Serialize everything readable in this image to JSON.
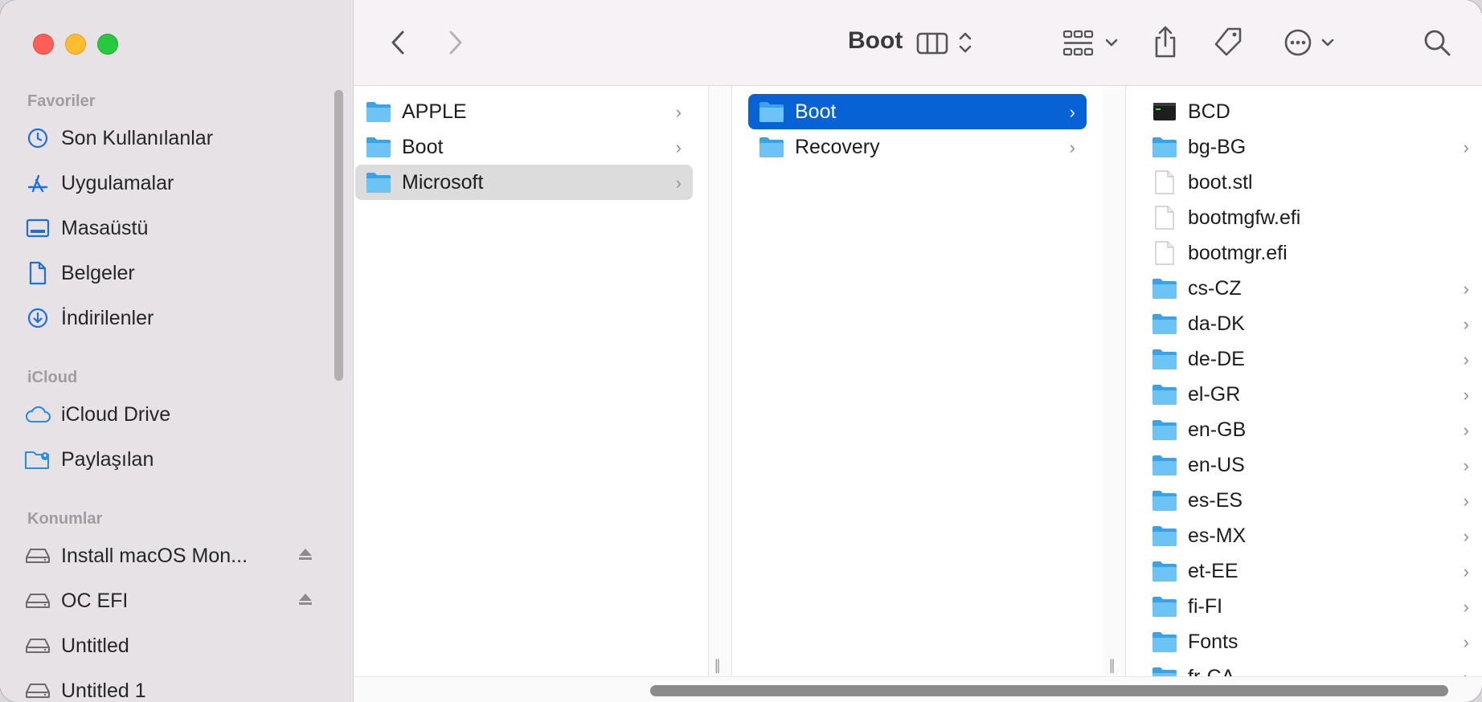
{
  "window": {
    "title": "Boot"
  },
  "sidebar": {
    "sections": [
      {
        "title": "Favoriler"
      },
      {
        "title": "iCloud"
      },
      {
        "title": "Konumlar"
      }
    ],
    "favorites": [
      {
        "label": "Son Kullanılanlar",
        "icon": "clock-icon"
      },
      {
        "label": "Uygulamalar",
        "icon": "apps-icon"
      },
      {
        "label": "Masaüstü",
        "icon": "desktop-icon"
      },
      {
        "label": "Belgeler",
        "icon": "document-icon"
      },
      {
        "label": "İndirilenler",
        "icon": "download-icon"
      }
    ],
    "icloud": [
      {
        "label": "iCloud Drive",
        "icon": "cloud-icon"
      },
      {
        "label": "Paylaşılan",
        "icon": "shared-folder-icon"
      }
    ],
    "locations": [
      {
        "label": "Install macOS Mon...",
        "icon": "drive-icon",
        "eject": true
      },
      {
        "label": "OC EFI",
        "icon": "drive-icon",
        "eject": true
      },
      {
        "label": "Untitled",
        "icon": "drive-icon"
      },
      {
        "label": "Untitled 1",
        "icon": "drive-icon"
      }
    ]
  },
  "toolbar": {
    "title": "Boot",
    "back": "back-icon",
    "forward": "forward-icon",
    "view": "column-view-icon",
    "group": "group-icon",
    "share": "share-icon",
    "tags": "tag-icon",
    "more": "more-icon",
    "search": "search-icon"
  },
  "columns": {
    "col1": [
      {
        "name": "APPLE",
        "type": "folder"
      },
      {
        "name": "Boot",
        "type": "folder"
      },
      {
        "name": "Microsoft",
        "type": "folder",
        "selected": "inactive"
      }
    ],
    "col2": [
      {
        "name": "Boot",
        "type": "folder",
        "selected": "active"
      },
      {
        "name": "Recovery",
        "type": "folder"
      }
    ],
    "col3": [
      {
        "name": "BCD",
        "type": "exec"
      },
      {
        "name": "bg-BG",
        "type": "folder"
      },
      {
        "name": "boot.stl",
        "type": "file"
      },
      {
        "name": "bootmgfw.efi",
        "type": "file"
      },
      {
        "name": "bootmgr.efi",
        "type": "file"
      },
      {
        "name": "cs-CZ",
        "type": "folder"
      },
      {
        "name": "da-DK",
        "type": "folder"
      },
      {
        "name": "de-DE",
        "type": "folder"
      },
      {
        "name": "el-GR",
        "type": "folder"
      },
      {
        "name": "en-GB",
        "type": "folder"
      },
      {
        "name": "en-US",
        "type": "folder"
      },
      {
        "name": "es-ES",
        "type": "folder"
      },
      {
        "name": "es-MX",
        "type": "folder"
      },
      {
        "name": "et-EE",
        "type": "folder"
      },
      {
        "name": "fi-FI",
        "type": "folder"
      },
      {
        "name": "Fonts",
        "type": "folder"
      },
      {
        "name": "fr-CA",
        "type": "folder"
      }
    ]
  },
  "colors": {
    "accent": "#0762d6",
    "folder": "#58b7f0"
  }
}
